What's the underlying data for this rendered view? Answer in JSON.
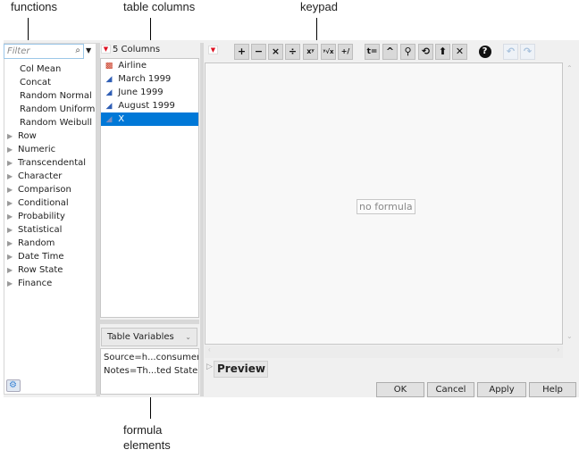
{
  "callouts": {
    "functions": "functions",
    "table_columns": "table columns",
    "keypad": "keypad",
    "formula_elements_line1": "formula",
    "formula_elements_line2": "elements"
  },
  "functions_panel": {
    "filter_placeholder": "Filter",
    "search_icon": "search-icon",
    "items": [
      {
        "label": "Col Mean",
        "expandable": false
      },
      {
        "label": "Concat",
        "expandable": false
      },
      {
        "label": "Random Normal",
        "expandable": false
      },
      {
        "label": "Random Uniform",
        "expandable": false
      },
      {
        "label": "Random Weibull",
        "expandable": false
      },
      {
        "label": "Row",
        "expandable": true
      },
      {
        "label": "Numeric",
        "expandable": true
      },
      {
        "label": "Transcendental",
        "expandable": true
      },
      {
        "label": "Character",
        "expandable": true
      },
      {
        "label": "Comparison",
        "expandable": true
      },
      {
        "label": "Conditional",
        "expandable": true
      },
      {
        "label": "Probability",
        "expandable": true
      },
      {
        "label": "Statistical",
        "expandable": true
      },
      {
        "label": "Random",
        "expandable": true
      },
      {
        "label": "Date Time",
        "expandable": true
      },
      {
        "label": "Row State",
        "expandable": true
      },
      {
        "label": "Finance",
        "expandable": true
      }
    ]
  },
  "columns_panel": {
    "header": "5 Columns",
    "items": [
      {
        "label": "Airline",
        "type": "nominal",
        "selected": false
      },
      {
        "label": "March 1999",
        "type": "continuous",
        "selected": false
      },
      {
        "label": "June 1999",
        "type": "continuous",
        "selected": false
      },
      {
        "label": "August 1999",
        "type": "continuous",
        "selected": false
      },
      {
        "label": "X",
        "type": "continuous",
        "selected": true
      }
    ],
    "variables_select": "Table Variables",
    "variables": [
      "Source=h...consumer/",
      "Notes=Th...ted States."
    ]
  },
  "keypad": {
    "keys": [
      {
        "name": "add",
        "glyph": "+"
      },
      {
        "name": "subtract",
        "glyph": "−"
      },
      {
        "name": "multiply",
        "glyph": "×"
      },
      {
        "name": "divide",
        "glyph": "÷"
      },
      {
        "name": "power",
        "glyph": "xʸ"
      },
      {
        "name": "root",
        "glyph": "ʸ√x"
      },
      {
        "name": "sign-change",
        "glyph": "+/−"
      },
      {
        "name": "assign",
        "glyph": "t="
      },
      {
        "name": "raise",
        "glyph": "^"
      },
      {
        "name": "peel",
        "glyph": "⚲"
      },
      {
        "name": "swap",
        "glyph": "⟲"
      },
      {
        "name": "local-variable",
        "glyph": "⬆"
      },
      {
        "name": "delete",
        "glyph": "✕"
      },
      {
        "name": "help",
        "glyph": "?"
      },
      {
        "name": "undo",
        "glyph": "↶"
      },
      {
        "name": "redo",
        "glyph": "↷"
      }
    ]
  },
  "editor": {
    "empty_text": "no formula",
    "preview_label": "Preview"
  },
  "buttons": {
    "ok": "OK",
    "cancel": "Cancel",
    "apply": "Apply",
    "help": "Help"
  },
  "colors": {
    "selection": "#0078d7",
    "nominal_icon": "#c8351e",
    "continuous_icon": "#2f5eb5",
    "dropdown_red": "#dd1122"
  }
}
